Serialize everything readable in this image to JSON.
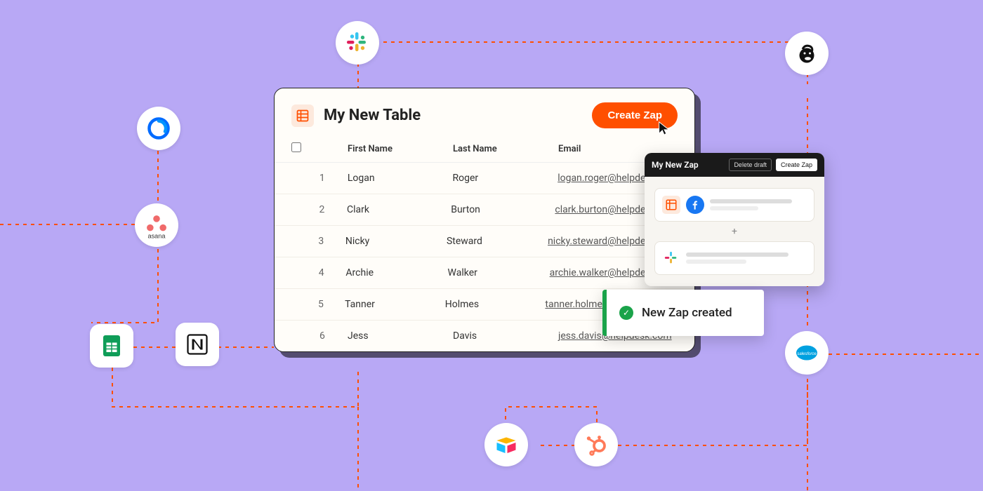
{
  "table": {
    "title": "My New Table",
    "create_zap": "Create Zap",
    "columns": {
      "first": "First Name",
      "last": "Last Name",
      "email": "Email"
    },
    "rows": [
      {
        "idx": "1",
        "first": "Logan",
        "last": "Roger",
        "email": "logan.roger@helpdesk.com"
      },
      {
        "idx": "2",
        "first": "Clark",
        "last": "Burton",
        "email": "clark.burton@helpdesk.com"
      },
      {
        "idx": "3",
        "first": "Nicky",
        "last": "Steward",
        "email": "nicky.steward@helpdesk.com"
      },
      {
        "idx": "4",
        "first": "Archie",
        "last": "Walker",
        "email": "archie.walker@helpdesk.com"
      },
      {
        "idx": "5",
        "first": "Tanner",
        "last": "Holmes",
        "email": "tanner.holmes@helpdesk.com"
      },
      {
        "idx": "6",
        "first": "Jess",
        "last": "Davis",
        "email": "jess.davis@helpdesk.com"
      }
    ]
  },
  "zap_editor": {
    "title": "My New Zap",
    "delete": "Delete draft",
    "create": "Create Zap",
    "plus": "+"
  },
  "toast": {
    "message": "New Zap created"
  },
  "integrations": {
    "slack": "slack-icon",
    "calendly": "calendly-icon",
    "asana": "asana-icon",
    "sheets": "google-sheets-icon",
    "notion": "notion-icon",
    "airtable": "airtable-icon",
    "hubspot": "hubspot-icon",
    "salesforce": "salesforce-icon",
    "mailchimp": "mailchimp-icon",
    "facebook": "facebook-icon",
    "tables": "zapier-tables-icon"
  },
  "colors": {
    "accent": "#ff4f00",
    "bg": "#b8a8f5",
    "success": "#1aa34a"
  }
}
